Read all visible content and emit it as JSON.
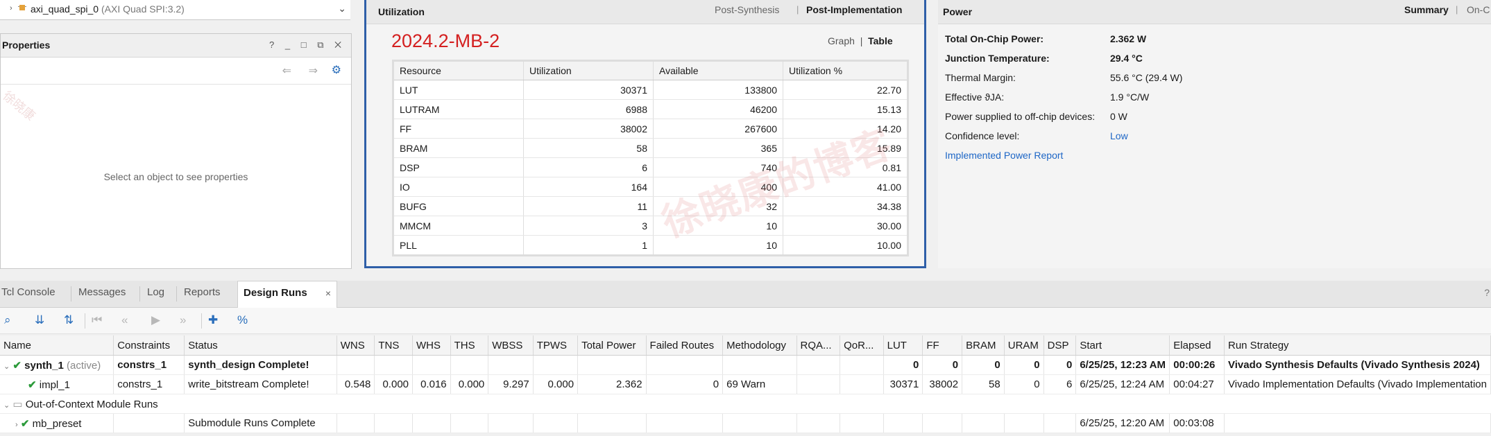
{
  "source": {
    "name": "axi_quad_spi_0",
    "type": "(AXI Quad SPI:3.2)"
  },
  "properties": {
    "title": "Properties",
    "empty_msg": "Select an object to see properties",
    "header_icons": "? _ □ ⧉ ✕"
  },
  "utilization": {
    "title": "Utilization",
    "tab_post_synth": "Post-Synthesis",
    "tab_post_impl": "Post-Implementation",
    "design_name": "2024.2-MB-2",
    "view_graph": "Graph",
    "view_table": "Table",
    "columns": [
      "Resource",
      "Utilization",
      "Available",
      "Utilization %"
    ],
    "rows": [
      [
        "LUT",
        "30371",
        "133800",
        "22.70"
      ],
      [
        "LUTRAM",
        "6988",
        "46200",
        "15.13"
      ],
      [
        "FF",
        "38002",
        "267600",
        "14.20"
      ],
      [
        "BRAM",
        "58",
        "365",
        "15.89"
      ],
      [
        "DSP",
        "6",
        "740",
        "0.81"
      ],
      [
        "IO",
        "164",
        "400",
        "41.00"
      ],
      [
        "BUFG",
        "11",
        "32",
        "34.38"
      ],
      [
        "MMCM",
        "3",
        "10",
        "30.00"
      ],
      [
        "PLL",
        "1",
        "10",
        "10.00"
      ]
    ]
  },
  "power": {
    "title": "Power",
    "tab_summary": "Summary",
    "tab_onchip": "On-C",
    "items": [
      {
        "k": "Total On-Chip Power:",
        "v": "2.362 W"
      },
      {
        "k": "Junction Temperature:",
        "v": "29.4 °C"
      },
      {
        "k": "Thermal Margin:",
        "v": "55.6 °C (29.4 W)"
      },
      {
        "k": "Effective ϑJA:",
        "v": "1.9 °C/W"
      },
      {
        "k": "Power supplied to off-chip devices:",
        "v": "0 W"
      },
      {
        "k": "Confidence level:",
        "v": "Low"
      }
    ],
    "report_link": "Implemented Power Report"
  },
  "tabs": {
    "tcl": "Tcl Console",
    "messages": "Messages",
    "log": "Log",
    "reports": "Reports",
    "design_runs": "Design Runs",
    "close": "×"
  },
  "runs": {
    "columns": [
      "Name",
      "Constraints",
      "Status",
      "WNS",
      "TNS",
      "WHS",
      "THS",
      "WBSS",
      "TPWS",
      "Total Power",
      "Failed Routes",
      "Methodology",
      "RQA...",
      "QoR...",
      "LUT",
      "FF",
      "BRAM",
      "URAM",
      "DSP",
      "Start",
      "Elapsed",
      "Run Strategy"
    ],
    "synth": {
      "name": "synth_1",
      "tag": "(active)",
      "constraints": "constrs_1",
      "status": "synth_design Complete!",
      "lut": "0",
      "ff": "0",
      "bram": "0",
      "uram": "0",
      "dsp": "0",
      "start": "6/25/25, 12:23 AM",
      "elapsed": "00:00:26",
      "strategy": "Vivado Synthesis Defaults (Vivado Synthesis 2024)"
    },
    "impl": {
      "name": "impl_1",
      "constraints": "constrs_1",
      "status": "write_bitstream Complete!",
      "wns": "0.548",
      "tns": "0.000",
      "whs": "0.016",
      "ths": "0.000",
      "wbss": "9.297",
      "tpws": "0.000",
      "power": "2.362",
      "failed": "0",
      "method": "69 Warn",
      "lut": "30371",
      "ff": "38002",
      "bram": "58",
      "uram": "0",
      "dsp": "6",
      "start": "6/25/25, 12:24 AM",
      "elapsed": "00:04:27",
      "strategy": "Vivado Implementation Defaults (Vivado Implementation"
    },
    "ooc": {
      "label": "Out-of-Context Module Runs"
    },
    "mb": {
      "name": "mb_preset",
      "status": "Submodule Runs Complete",
      "start": "6/25/25, 12:20 AM",
      "elapsed": "00:03:08"
    }
  }
}
